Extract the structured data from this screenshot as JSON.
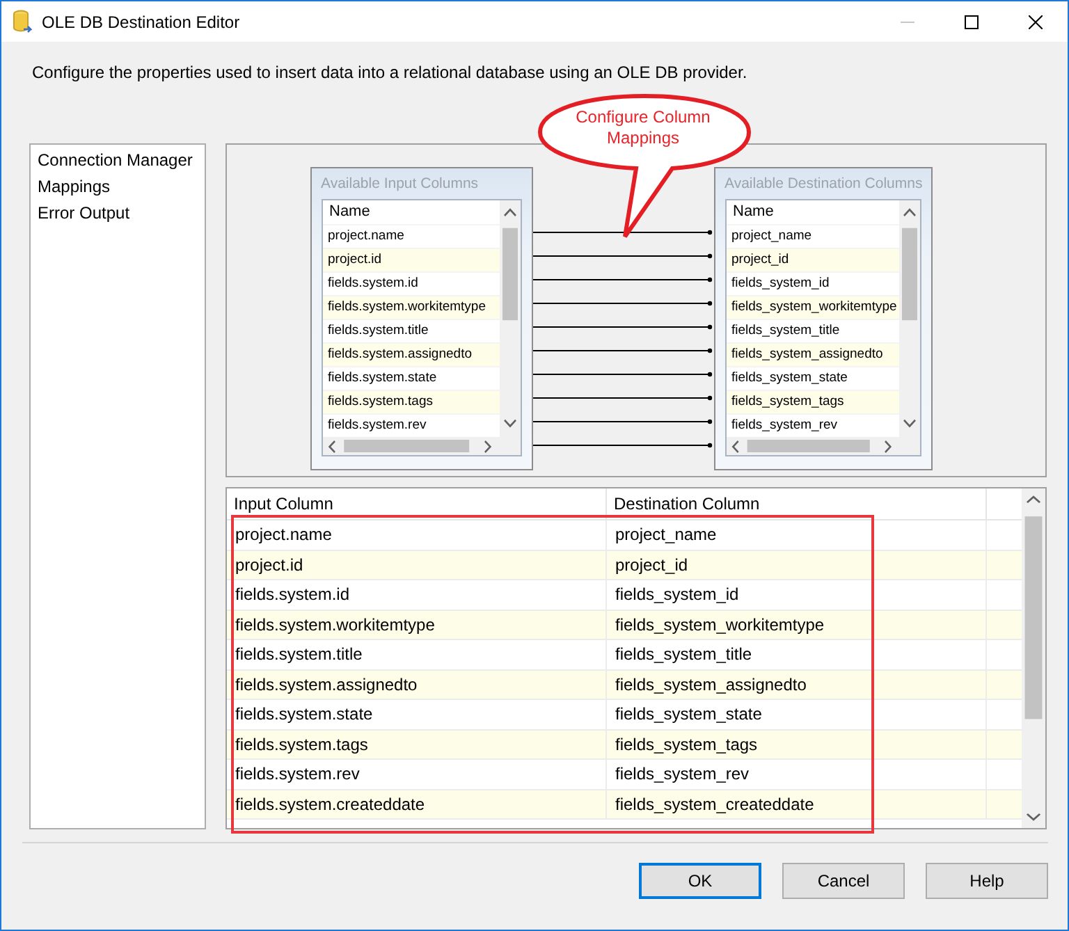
{
  "window": {
    "title": "OLE DB Destination Editor"
  },
  "description": "Configure the properties used to insert data into a relational database using an OLE DB provider.",
  "navigation": [
    {
      "label": "Connection Manager"
    },
    {
      "label": "Mappings"
    },
    {
      "label": "Error Output"
    }
  ],
  "callout": "Configure Column Mappings",
  "available_input_columns": {
    "title": "Available Input Columns",
    "header": "Name",
    "items": [
      "project.name",
      "project.id",
      "fields.system.id",
      "fields.system.workitemtype",
      "fields.system.title",
      "fields.system.assignedto",
      "fields.system.state",
      "fields.system.tags",
      "fields.system.rev"
    ]
  },
  "available_destination_columns": {
    "title": "Available Destination Columns",
    "header": "Name",
    "items": [
      "project_name",
      "project_id",
      "fields_system_id",
      "fields_system_workitemtype",
      "fields_system_title",
      "fields_system_assignedto",
      "fields_system_state",
      "fields_system_tags",
      "fields_system_rev"
    ]
  },
  "mapping_grid": {
    "columns": [
      "Input Column",
      "Destination Column"
    ],
    "rows": [
      {
        "input": "project.name",
        "destination": "project_name"
      },
      {
        "input": "project.id",
        "destination": "project_id"
      },
      {
        "input": "fields.system.id",
        "destination": "fields_system_id"
      },
      {
        "input": "fields.system.workitemtype",
        "destination": "fields_system_workitemtype"
      },
      {
        "input": "fields.system.title",
        "destination": "fields_system_title"
      },
      {
        "input": "fields.system.assignedto",
        "destination": "fields_system_assignedto"
      },
      {
        "input": "fields.system.state",
        "destination": "fields_system_state"
      },
      {
        "input": "fields.system.tags",
        "destination": "fields_system_tags"
      },
      {
        "input": "fields.system.rev",
        "destination": "fields_system_rev"
      },
      {
        "input": "fields.system.createddate",
        "destination": "fields_system_createddate"
      }
    ]
  },
  "buttons": [
    {
      "label": "OK",
      "default": true
    },
    {
      "label": "Cancel",
      "default": false
    },
    {
      "label": "Help",
      "default": false
    }
  ]
}
